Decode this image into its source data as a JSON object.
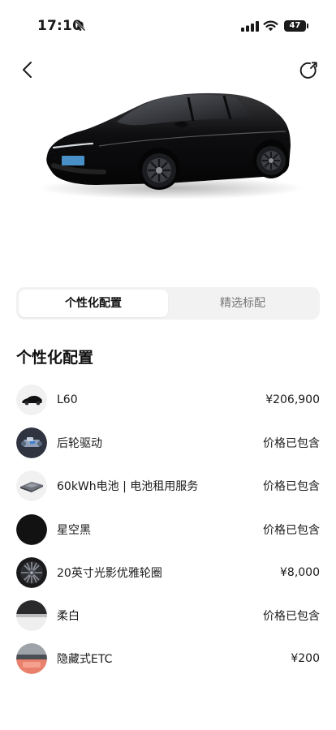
{
  "status_bar": {
    "time": "17:10",
    "battery_level": "47",
    "icons": [
      "bell-off-icon",
      "signal-icon",
      "wifi-icon",
      "battery-icon"
    ]
  },
  "nav": {
    "back_icon": "chevron-left-icon",
    "share_icon": "share-icon"
  },
  "hero": {
    "car_color": "#0f0f10",
    "plate_color": "#4a90c8"
  },
  "tabs": [
    {
      "label": "个性化配置",
      "active": true
    },
    {
      "label": "精选标配",
      "active": false
    }
  ],
  "section": {
    "title": "个性化配置"
  },
  "config_items": [
    {
      "label": "L60",
      "price": "¥206,900",
      "thumb": "car-thumbnail"
    },
    {
      "label": "后轮驱动",
      "price": "价格已包含",
      "thumb": "drivetrain-thumbnail"
    },
    {
      "label": "60kWh电池 | 电池租用服务",
      "price": "价格已包含",
      "thumb": "battery-pack-thumbnail"
    },
    {
      "label": "星空黑",
      "price": "价格已包含",
      "thumb": "paint-color-swatch",
      "swatch": "#121212"
    },
    {
      "label": "20英寸光影优雅轮圈",
      "price": "¥8,000",
      "thumb": "wheel-rim-thumbnail"
    },
    {
      "label": "柔白",
      "price": "价格已包含",
      "thumb": "interior-color-swatch",
      "swatch": "#f2f2f2"
    },
    {
      "label": "隐藏式ETC",
      "price": "¥200",
      "thumb": "etc-device-thumbnail"
    }
  ]
}
